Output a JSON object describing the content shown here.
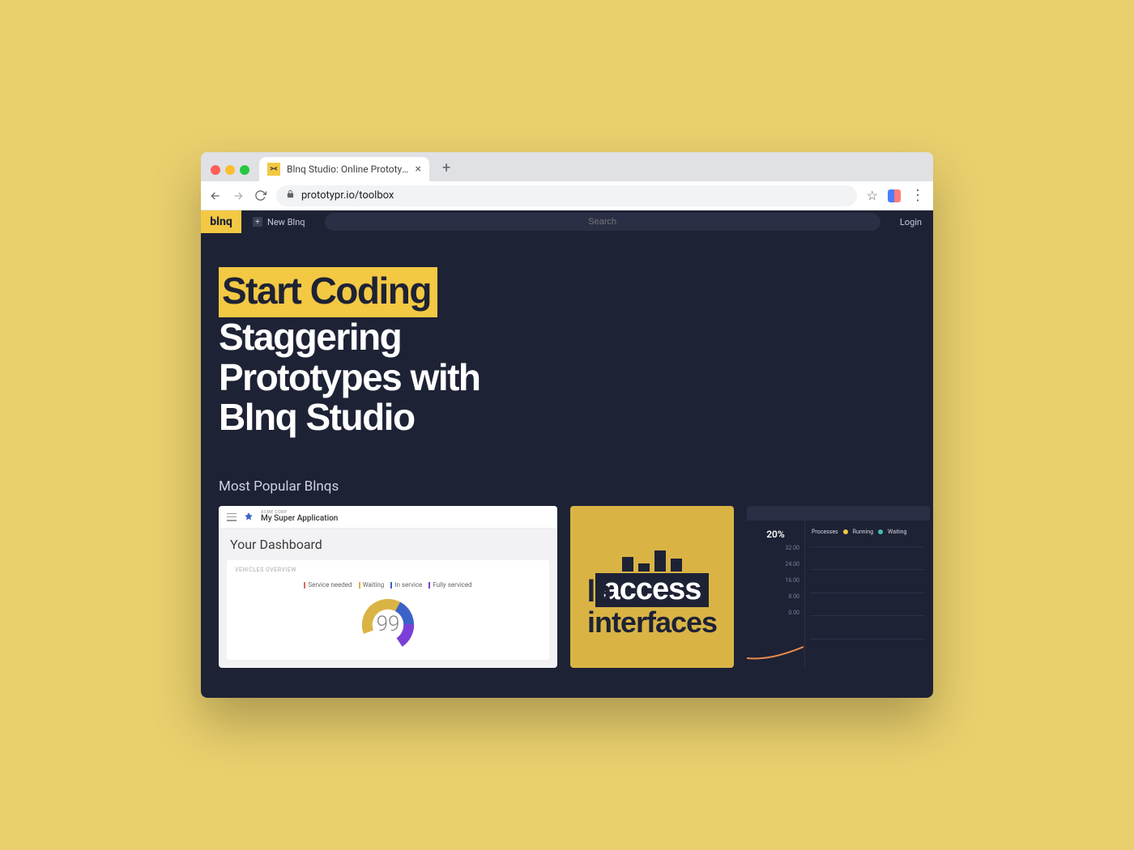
{
  "browser": {
    "tab_title": "Blnq Studio: Online Prototyping P",
    "url": "prototypr.io/toolbox",
    "favicon_glyph": "><"
  },
  "app_header": {
    "logo_text": "blnq",
    "new_blnq_label": "New Blnq",
    "search_placeholder": "Search",
    "login_label": "Login"
  },
  "hero": {
    "highlight": "Start Coding",
    "line2": "Staggering",
    "line3": "Prototypes with",
    "line4": "Blnq Studio"
  },
  "section_title": "Most Popular Blnqs",
  "card1": {
    "company": "acme corp",
    "app_name": "My Super Application",
    "dashboard_title": "Your Dashboard",
    "panel_label": "VEHICLES OVERVIEW",
    "legend": {
      "a": "Service needed",
      "b": "Waiting",
      "c": "In service",
      "d": "Fully serviced"
    },
    "donut_value": "99"
  },
  "card2": {
    "prefix": "la",
    "word": "access",
    "sub": "interfaces"
  },
  "card3": {
    "percent": "20%",
    "axis": [
      "32.00",
      "24.00",
      "16.00",
      "8.00",
      "0.00"
    ],
    "legend_label": "Processes",
    "series_a": "Running",
    "series_b": "Waiting"
  }
}
